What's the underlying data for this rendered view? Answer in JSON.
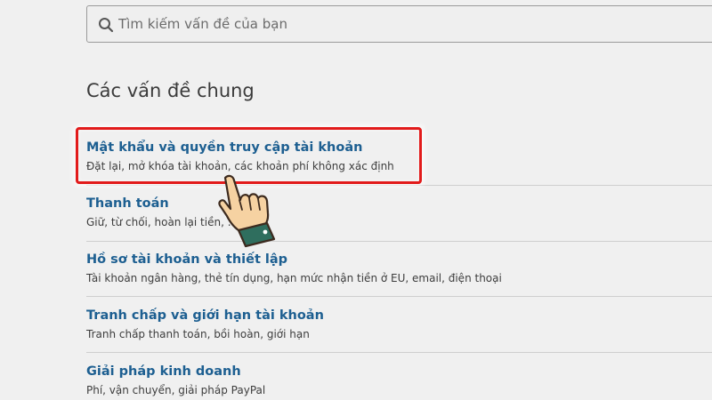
{
  "search": {
    "placeholder": "Tìm kiếm vấn đề của bạn",
    "value": ""
  },
  "section": {
    "heading": "Các vấn đề chung"
  },
  "topics": [
    {
      "title": "Mật khẩu và quyền truy cập tài khoản",
      "description": "Đặt lại, mở khóa tài khoản, các khoản phí không xác định"
    },
    {
      "title": "Thanh toán",
      "description": "Giữ, từ chối, hoàn lại tiền, ..."
    },
    {
      "title": "Hồ sơ tài khoản và thiết lập",
      "description": "Tài khoản ngân hàng, thẻ tín dụng, hạn mức nhận tiền ở EU, email, điện thoại"
    },
    {
      "title": "Tranh chấp và giới hạn tài khoản",
      "description": "Tranh chấp thanh toán, bồi hoàn, giới hạn"
    },
    {
      "title": "Giải pháp kinh doanh",
      "description": "Phí, vận chuyển, giải pháp PayPal"
    }
  ],
  "annotation": {
    "highlight_color": "#e21b1b",
    "pointer_icon": "hand-pointer-icon"
  },
  "colors": {
    "link": "#1d5f91",
    "background": "#f0f0f0",
    "text": "#3d3d3d"
  }
}
